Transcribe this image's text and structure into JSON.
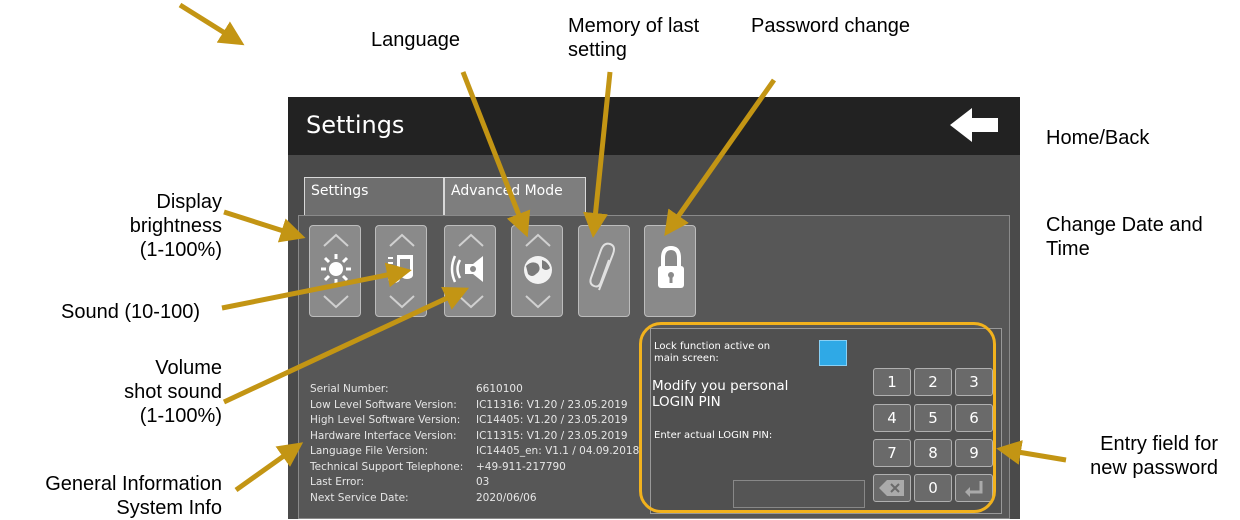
{
  "annotations": {
    "language": "Language",
    "memory": [
      "Memory of last",
      "setting"
    ],
    "password": "Password change",
    "home_back": "Home/Back",
    "change_date": [
      "Change Date and",
      "Time"
    ],
    "display": [
      "Display",
      "brightness",
      "(1-100%)"
    ],
    "sound": "Sound (10-100)",
    "volume": [
      "Volume",
      "shot sound",
      "(1-100%)"
    ],
    "general": [
      "General Information",
      "System Info"
    ],
    "entry": [
      "Entry field for",
      "new password"
    ]
  },
  "screen": {
    "title": "Settings",
    "tabs": [
      "Settings",
      "Advanced Mode"
    ],
    "buttons": [
      "brightness-icon",
      "music-note-icon",
      "speaker-volume-icon",
      "globe-icon",
      "paperclip-icon",
      "lock-icon"
    ]
  },
  "info": {
    "labels": [
      "Serial Number:",
      "Low Level Software Version:",
      "High Level Software Version:",
      "Hardware Interface Version:",
      "Language File Version:",
      "Technical Support Telephone:",
      "Last Error:",
      "Next Service Date:"
    ],
    "values": [
      "6610100",
      "IC11316: V1.20 / 23.05.2019",
      "IC14405: V1.20 / 23.05.2019",
      "IC11315: V1.20 / 23.05.2019",
      "IC14405_en: V1.1 / 04.09.2018",
      "+49-911-217790",
      "03",
      "2020/06/06"
    ]
  },
  "lock": {
    "active_label": [
      "Lock function active on",
      "main screen:"
    ],
    "modify_label": [
      "Modify you personal",
      "LOGIN PIN"
    ],
    "enter_label": "Enter actual LOGIN PIN:",
    "keys": [
      "1",
      "2",
      "3",
      "4",
      "5",
      "6",
      "7",
      "8",
      "9",
      "0"
    ]
  },
  "colors": {
    "arrow": "#c39514",
    "highlight": "#f2b21d",
    "checkbox": "#2fa9e6"
  }
}
